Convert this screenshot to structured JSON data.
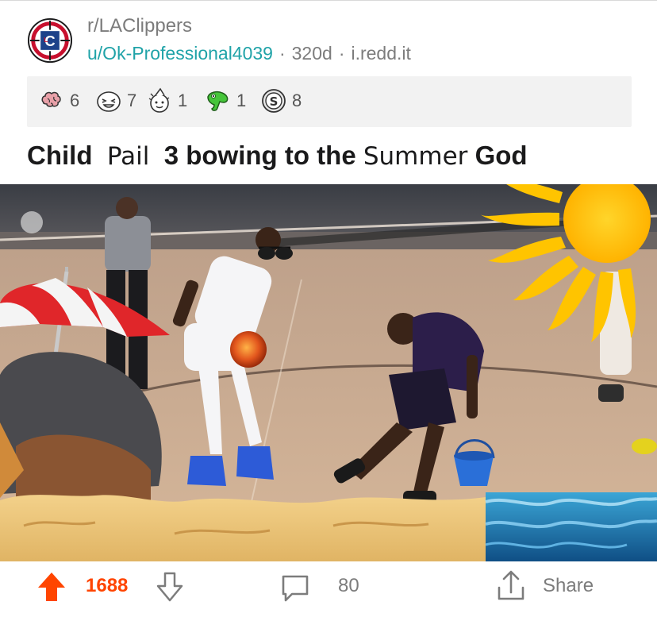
{
  "post": {
    "subreddit": "r/LAClippers",
    "author": "u/Ok-Professional4039",
    "age": "320d",
    "domain": "i.redd.it",
    "title_parts": [
      "Child",
      "Pail",
      "3 bowing to the",
      "Summer",
      "God"
    ]
  },
  "awards": [
    {
      "icon": "brain-award-icon",
      "count": "6"
    },
    {
      "icon": "laughing-face-award-icon",
      "count": "7"
    },
    {
      "icon": "party-face-award-icon",
      "count": "1"
    },
    {
      "icon": "green-lizard-award-icon",
      "count": "1"
    },
    {
      "icon": "coin-award-icon",
      "count": "8"
    }
  ],
  "actions": {
    "score": "1688",
    "comments": "80",
    "share": "Share"
  },
  "colors": {
    "upvote": "#ff4500",
    "author_link": "#20a3a8",
    "muted": "#7c7c7c",
    "awards_bg": "#f2f2f2"
  }
}
